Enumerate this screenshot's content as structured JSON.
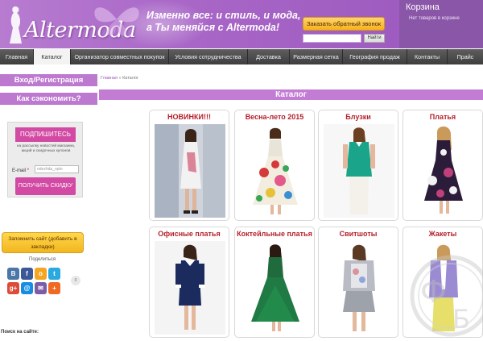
{
  "header": {
    "logo_text": "Altermoda",
    "tagline_line1": "Изменно все: и стиль, и мода,",
    "tagline_line2": "а Ты меняйся с Altermoda!",
    "callback_label": "Заказать обратный звонок",
    "search_button_label": "Найти",
    "cart_title": "Корзина",
    "cart_status": "Нет товаров в корзине"
  },
  "nav": {
    "items": [
      {
        "label": "Главная"
      },
      {
        "label": "Каталог"
      },
      {
        "label": "Организатор совместных покупок"
      },
      {
        "label": "Условия сотрудничества"
      },
      {
        "label": "Доставка"
      },
      {
        "label": "Размерная сетка"
      },
      {
        "label": "География продаж"
      },
      {
        "label": "Контакты"
      },
      {
        "label": "Прайс"
      }
    ],
    "active": "Каталог"
  },
  "sidebar": {
    "login_label": "Вход/Регистрация",
    "save_label": "Как сэкономить?",
    "subscribe_title": "ПОДПИШИТЕСЬ",
    "subscribe_text": "на рассылку новостей магазина, акций и скидочных купонов",
    "email_label": "E-mail",
    "email_placeholder": "odezhda_opto",
    "subscribe_button": "ПОЛУЧИТЬ СКИДКУ",
    "bookmark_label": "Запомнить сайт (добавить в закладки)",
    "share_label": "Поделиться",
    "share_count": "0",
    "site_search_label": "Поиск на сайте:"
  },
  "breadcrumb": {
    "home": "Главная",
    "separator": "»",
    "current": "Каталог"
  },
  "catalog": {
    "title": "Каталог",
    "cards": [
      {
        "title": "НОВИНКИ!!!"
      },
      {
        "title": "Весна-лето 2015"
      },
      {
        "title": "Блузки"
      },
      {
        "title": "Платья"
      },
      {
        "title": "Офисные платья"
      },
      {
        "title": "Коктейльные платья"
      },
      {
        "title": "Свитшоты"
      },
      {
        "title": "Жакеты"
      }
    ]
  },
  "social_icons": [
    {
      "name": "vk-icon",
      "glyph": "В",
      "color": "#4a76a8"
    },
    {
      "name": "facebook-icon",
      "glyph": "f",
      "color": "#3b5998"
    },
    {
      "name": "odnoklassniki-icon",
      "glyph": "о",
      "color": "#f4a623"
    },
    {
      "name": "twitter-icon",
      "glyph": "t",
      "color": "#2aa9e0"
    },
    {
      "name": "google-plus-icon",
      "glyph": "g+",
      "color": "#dd4b39"
    },
    {
      "name": "mailru-icon",
      "glyph": "@",
      "color": "#168de2"
    },
    {
      "name": "email-icon",
      "glyph": "✉",
      "color": "#7d5ca6"
    },
    {
      "name": "more-icon",
      "glyph": "+",
      "color": "#ef6a24"
    }
  ],
  "colors": {
    "accent": "#bd79cf",
    "title_red": "#b51f2a",
    "subscribe_pink": "#d24aa3",
    "button_yellow": "#f5b21e"
  }
}
